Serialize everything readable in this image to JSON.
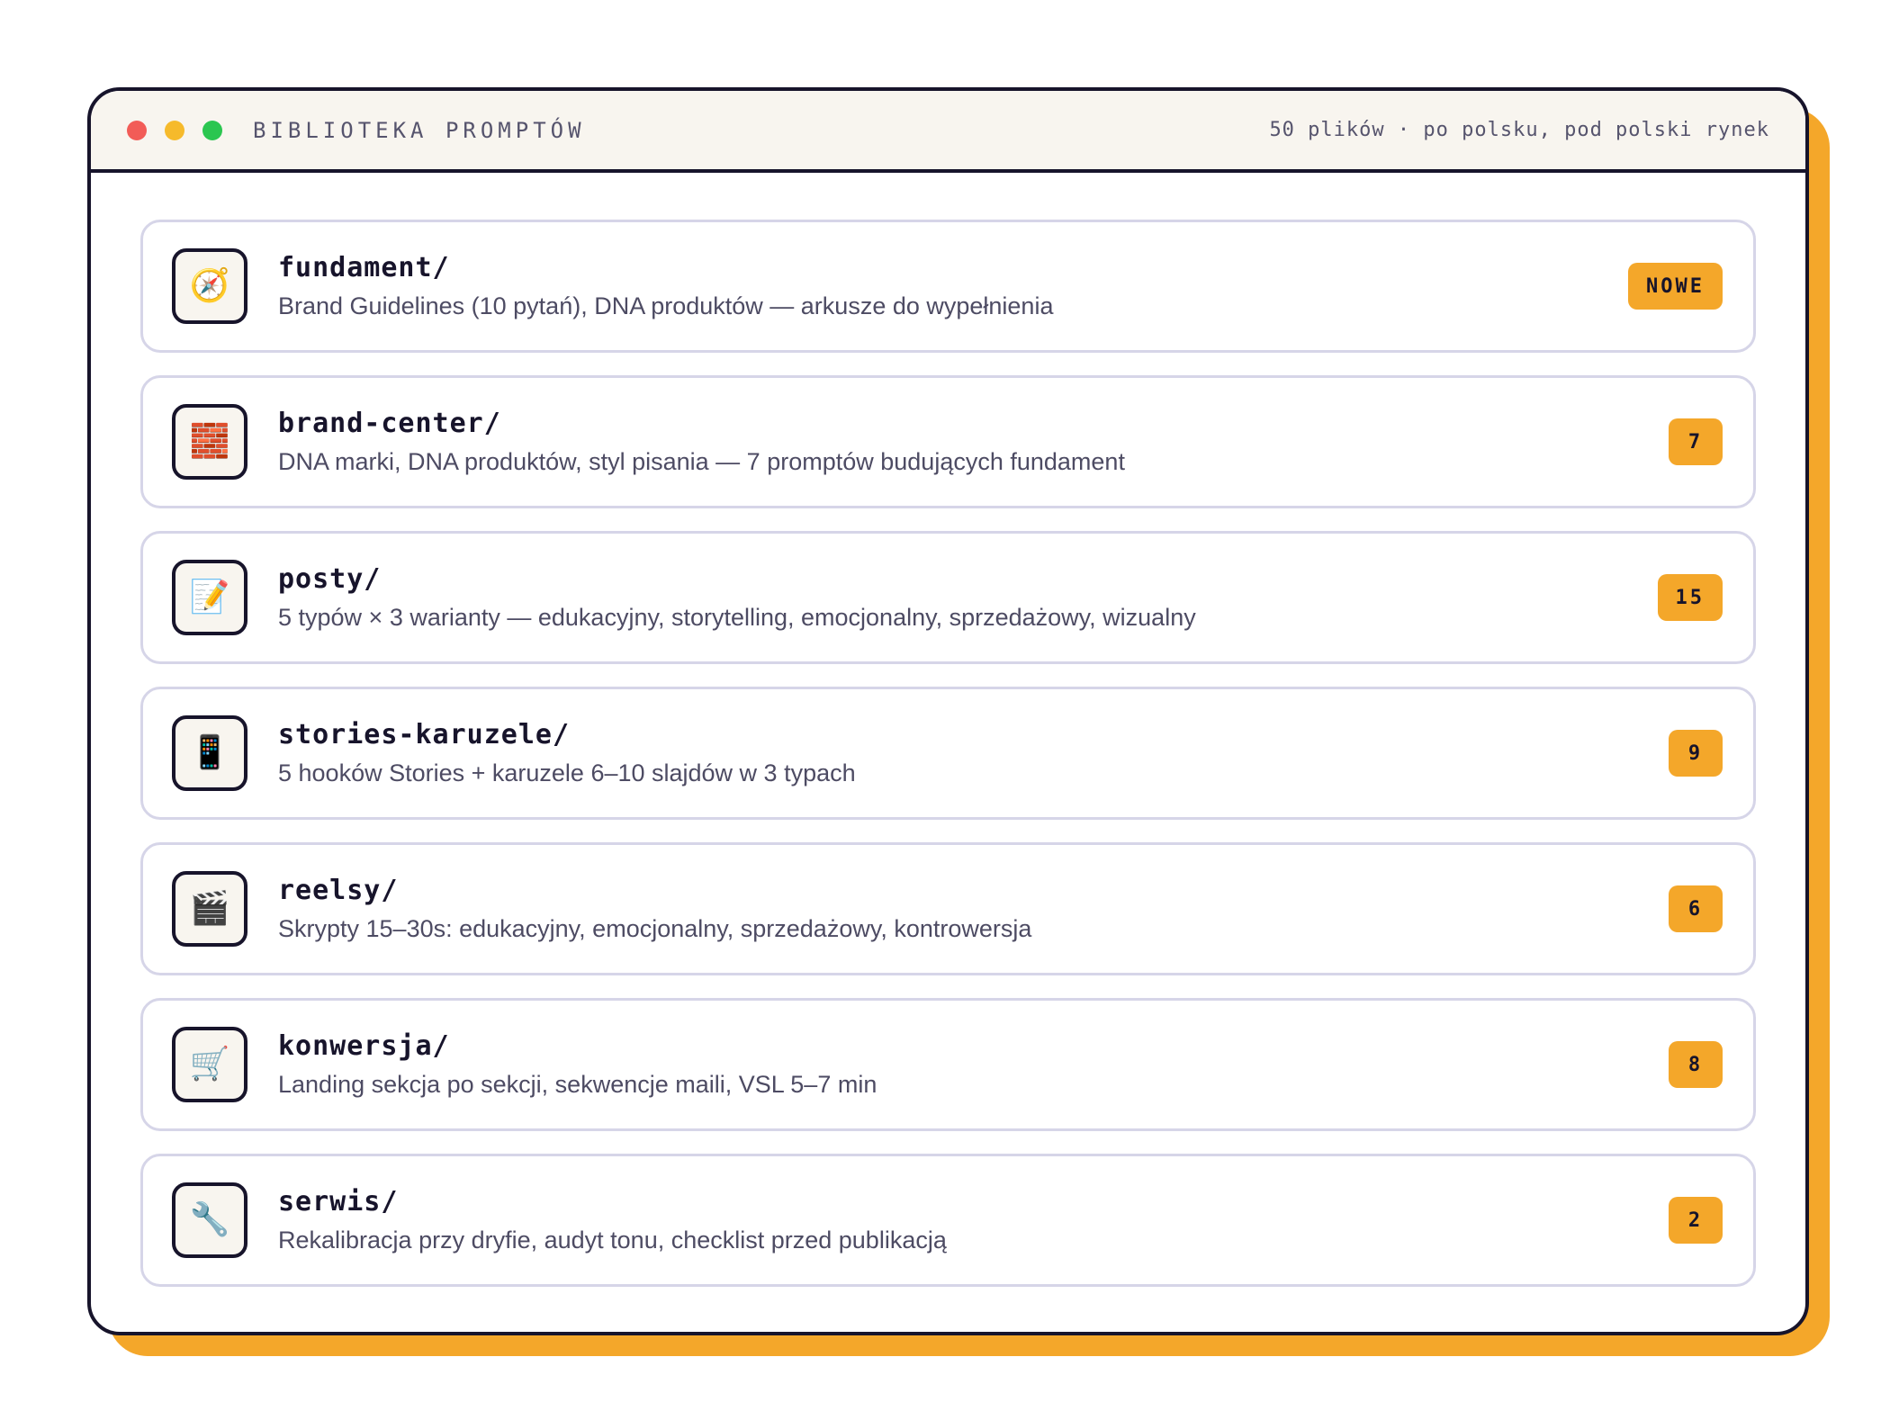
{
  "window": {
    "title": "BIBLIOTEKA PROMPTÓW",
    "meta": "50 plików · po polsku, pod polski rynek",
    "controls": [
      "close",
      "minimize",
      "maximize"
    ]
  },
  "colors": {
    "accent": "#f4a72a",
    "border": "#17142b",
    "row_border": "#d6d5e8",
    "close": "#f25c57",
    "minimize": "#f6ba2b",
    "maximize": "#2bc650"
  },
  "folders": [
    {
      "icon": "🧭",
      "icon_name": "compass-icon",
      "name": "fundament/",
      "description": "Brand Guidelines (10 pytań), DNA produktów — arkusze do wypełnienia",
      "badge": "NOWE"
    },
    {
      "icon": "🧱",
      "icon_name": "bricks-icon",
      "name": "brand-center/",
      "description": "DNA marki, DNA produktów, styl pisania — 7 promptów budujących fundament",
      "badge": "7"
    },
    {
      "icon": "📝",
      "icon_name": "memo-icon",
      "name": "posty/",
      "description": "5 typów × 3 warianty — edukacyjny, storytelling, emocjonalny, sprzedażowy, wizualny",
      "badge": "15"
    },
    {
      "icon": "📱",
      "icon_name": "phone-icon",
      "name": "stories-karuzele/",
      "description": "5 hooków Stories + karuzele 6–10 slajdów w 3 typach",
      "badge": "9"
    },
    {
      "icon": "🎬",
      "icon_name": "clapperboard-icon",
      "name": "reelsy/",
      "description": "Skrypty 15–30s: edukacyjny, emocjonalny, sprzedażowy, kontrowersja",
      "badge": "6"
    },
    {
      "icon": "🛒",
      "icon_name": "cart-icon",
      "name": "konwersja/",
      "description": "Landing sekcja po sekcji, sekwencje maili, VSL 5–7 min",
      "badge": "8"
    },
    {
      "icon": "🔧",
      "icon_name": "wrench-icon",
      "name": "serwis/",
      "description": "Rekalibracja przy dryfie, audyt tonu, checklist przed publikacją",
      "badge": "2"
    }
  ]
}
